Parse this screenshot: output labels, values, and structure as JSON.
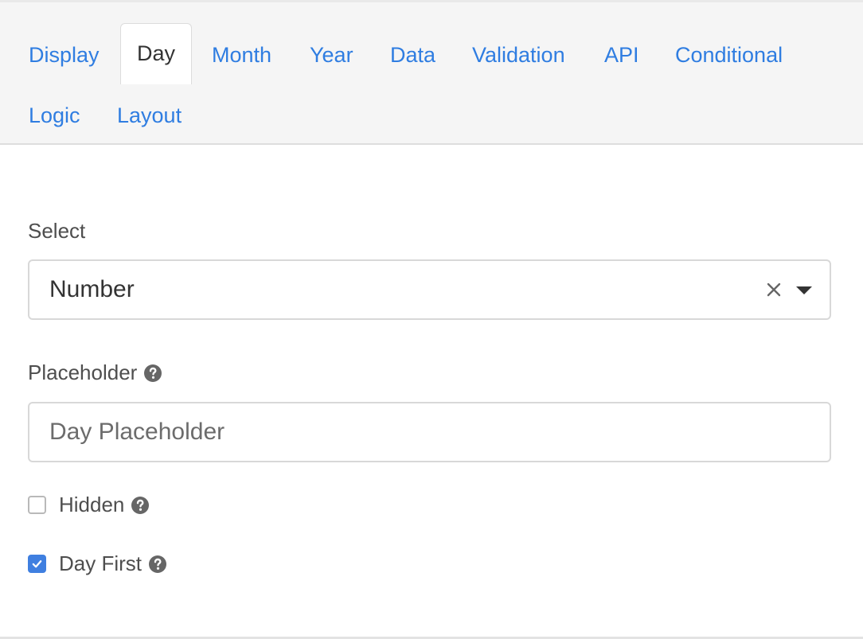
{
  "tabs": [
    {
      "label": "Display",
      "active": false
    },
    {
      "label": "Day",
      "active": true
    },
    {
      "label": "Month",
      "active": false
    },
    {
      "label": "Year",
      "active": false
    },
    {
      "label": "Data",
      "active": false
    },
    {
      "label": "Validation",
      "active": false
    },
    {
      "label": "API",
      "active": false
    },
    {
      "label": "Conditional",
      "active": false
    },
    {
      "label": "Logic",
      "active": false
    },
    {
      "label": "Layout",
      "active": false
    }
  ],
  "select_field": {
    "label": "Select",
    "value": "Number"
  },
  "placeholder_field": {
    "label": "Placeholder",
    "placeholder": "Day Placeholder",
    "value": ""
  },
  "hidden_option": {
    "label": "Hidden",
    "checked": false
  },
  "day_first_option": {
    "label": "Day First",
    "checked": true
  },
  "icons": {
    "help": "question-circle-icon",
    "clear": "close-icon",
    "dropdown": "caret-down-icon",
    "check": "checkmark-icon"
  },
  "colors": {
    "link": "#2f7de1",
    "checkbox_checked": "#3f7fe0",
    "help_icon": "#666666"
  }
}
